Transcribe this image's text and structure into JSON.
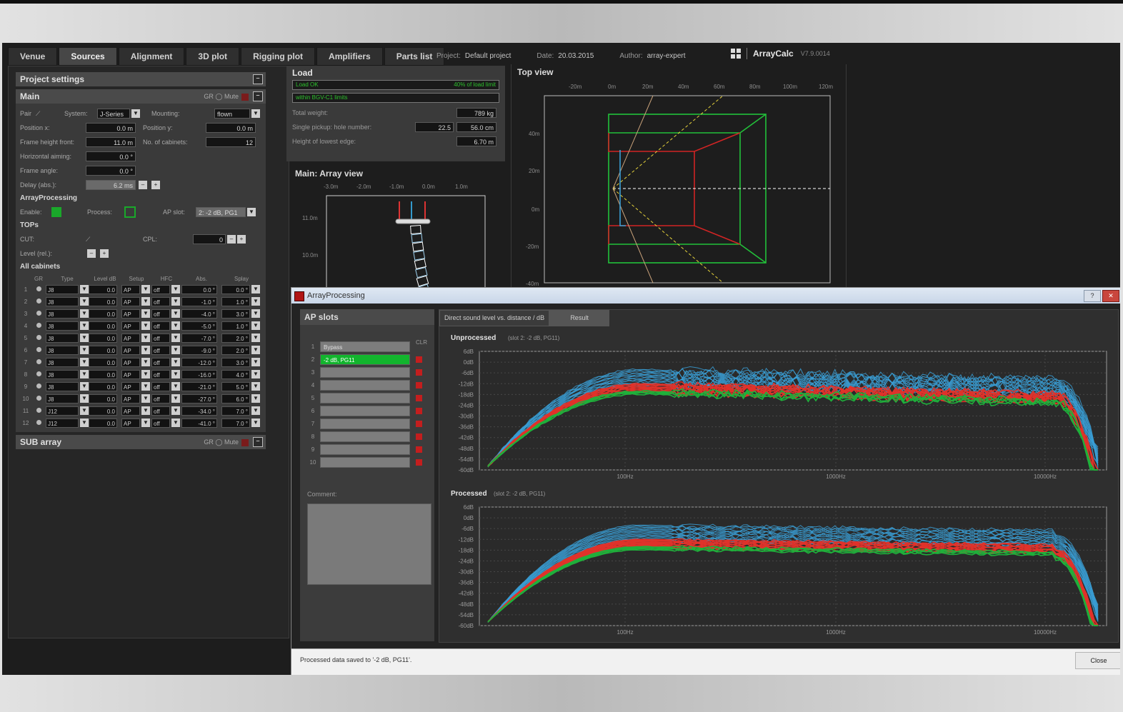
{
  "tabs": [
    "Venue",
    "Sources",
    "Alignment",
    "3D plot",
    "Rigging plot",
    "Amplifiers",
    "Parts list"
  ],
  "active_tab": "Sources",
  "meta": {
    "project_label": "Project:",
    "project": "Default project",
    "date_label": "Date:",
    "date": "20.03.2015",
    "author_label": "Author:",
    "author": "array-expert"
  },
  "brand": {
    "name": "ArrayCalc",
    "version": "V7.9.0014"
  },
  "left": {
    "project_settings": "Project settings",
    "main": "Main",
    "gr": "GR",
    "mute": "Mute",
    "pair": "Pair",
    "system_label": "System:",
    "system_value": "J-Series",
    "mounting_label": "Mounting:",
    "mounting_value": "flown",
    "position_x_label": "Position x:",
    "position_x": "0.0 m",
    "position_y_label": "Position y:",
    "position_y": "0.0 m",
    "frame_height_label": "Frame height front:",
    "frame_height": "11.0 m",
    "num_cabinets_label": "No. of cabinets:",
    "num_cabinets": "12",
    "horizontal_aiming_label": "Horizontal aiming:",
    "horizontal_aiming": "0.0 °",
    "frame_angle_label": "Frame angle:",
    "frame_angle": "0.0 °",
    "delay_label": "Delay (abs.):",
    "delay": "6.2 ms",
    "array_processing": "ArrayProcessing",
    "enable_label": "Enable:",
    "process_label": "Process:",
    "ap_slot_label": "AP slot:",
    "ap_slot_value": "2: -2 dB, PG1",
    "tops": "TOPs",
    "cut_label": "CUT:",
    "cpl_label": "CPL:",
    "cpl_value": "0",
    "level_label": "Level (rel.):",
    "all_cabinets": "All cabinets",
    "sub_array": "SUB array",
    "cab_headers": [
      "GR",
      "Type",
      "Level dB",
      "Setup",
      "HFC",
      "Abs.",
      "Splay"
    ],
    "cabinets": [
      [
        "1",
        "J8",
        "0.0",
        "AP",
        "off",
        "0.0 °",
        "0.0 °"
      ],
      [
        "2",
        "J8",
        "0.0",
        "AP",
        "off",
        "-1.0 °",
        "1.0 °"
      ],
      [
        "3",
        "J8",
        "0.0",
        "AP",
        "off",
        "-4.0 °",
        "3.0 °"
      ],
      [
        "4",
        "J8",
        "0.0",
        "AP",
        "off",
        "-5.0 °",
        "1.0 °"
      ],
      [
        "5",
        "J8",
        "0.0",
        "AP",
        "off",
        "-7.0 °",
        "2.0 °"
      ],
      [
        "6",
        "J8",
        "0.0",
        "AP",
        "off",
        "-9.0 °",
        "2.0 °"
      ],
      [
        "7",
        "J8",
        "0.0",
        "AP",
        "off",
        "-12.0 °",
        "3.0 °"
      ],
      [
        "8",
        "J8",
        "0.0",
        "AP",
        "off",
        "-16.0 °",
        "4.0 °"
      ],
      [
        "9",
        "J8",
        "0.0",
        "AP",
        "off",
        "-21.0 °",
        "5.0 °"
      ],
      [
        "10",
        "J8",
        "0.0",
        "AP",
        "off",
        "-27.0 °",
        "6.0 °"
      ],
      [
        "11",
        "J12",
        "0.0",
        "AP",
        "off",
        "-34.0 °",
        "7.0 °"
      ],
      [
        "12",
        "J12",
        "0.0",
        "AP",
        "off",
        "-41.0 °",
        "7.0 °"
      ]
    ]
  },
  "load": {
    "title": "Load",
    "status": "Load OK",
    "status_right": "40% of load limit",
    "limits": "within BGV-C1 limits",
    "total_weight_label": "Total weight:",
    "total_weight": "789 kg",
    "single_pickup_label": "Single pickup: hole number:",
    "single_pickup_num": "22.5",
    "single_pickup_cm": "56.0 cm",
    "lowest_edge_label": "Height of lowest edge:",
    "lowest_edge": "6.70 m"
  },
  "array_view": {
    "title": "Main: Array view",
    "xticks": [
      "-3.0m",
      "-2.0m",
      "-1.0m",
      "0.0m",
      "1.0m"
    ],
    "yticks": [
      "11.0m",
      "10.0m"
    ]
  },
  "top_view": {
    "title": "Top view",
    "xticks": [
      "-20m",
      "0m",
      "20m",
      "40m",
      "60m",
      "80m",
      "100m",
      "120m"
    ],
    "yticks": [
      "40m",
      "20m",
      "0m",
      "-20m",
      "-40m"
    ]
  },
  "dialog": {
    "title": "ArrayProcessing",
    "ap_slots": "AP slots",
    "clr": "CLR",
    "slots": [
      "Bypass",
      "-2 dB, PG11",
      "",
      "",
      "",
      "",
      "",
      "",
      "",
      ""
    ],
    "selected_slot": 2,
    "comment": "Comment:",
    "plot_tab": "Direct sound level vs. distance / dB",
    "result_tab": "Result",
    "unprocessed_title": "Unprocessed",
    "unprocessed_sub": "(slot 2: -2 dB, PG11)",
    "processed_title": "Processed",
    "processed_sub": "(slot 2: -2 dB, PG11)",
    "yticks": [
      "6dB",
      "0dB",
      "-6dB",
      "-12dB",
      "-18dB",
      "-24dB",
      "-30dB",
      "-36dB",
      "-42dB",
      "-48dB",
      "-54dB",
      "-60dB"
    ],
    "xticks": [
      "100Hz",
      "1000Hz",
      "10000Hz"
    ],
    "status": "Processed data saved to '-2 dB, PG11'.",
    "close": "Close"
  },
  "colors": {
    "accent_green": "#12b52d",
    "curve_blue": "#3a9fd6",
    "curve_red": "#e0322a",
    "curve_green": "#1fb03b",
    "top_green": "#22c23a",
    "top_red": "#d12424"
  }
}
